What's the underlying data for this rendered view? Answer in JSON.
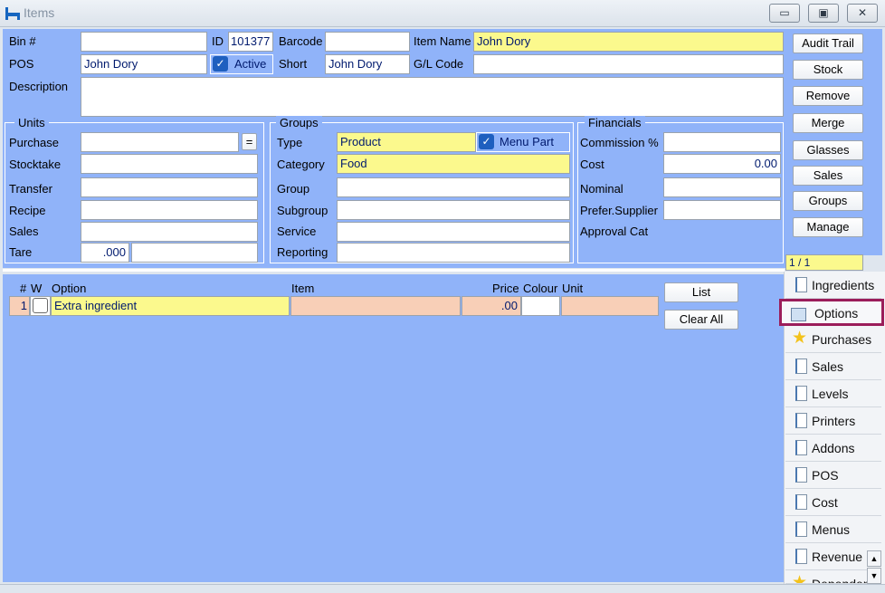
{
  "window": {
    "title": "Items",
    "controls": [
      "▭",
      "▣",
      "✕"
    ]
  },
  "header": {
    "bin_label": "Bin #",
    "bin_value": "",
    "id_label": "ID",
    "id_value": "101377",
    "barcode_label": "Barcode",
    "barcode_value": "",
    "item_name_label": "Item Name",
    "item_name_value": "John Dory",
    "pos_label": "POS",
    "pos_value": "John Dory",
    "active_label": "Active",
    "short_label": "Short",
    "short_value": "John Dory",
    "gl_code_label": "G/L Code",
    "gl_code_value": "",
    "description_label": "Description",
    "description_value": ""
  },
  "units": {
    "title": "Units",
    "purchase_label": "Purchase",
    "purchase_value": "",
    "eq_button": "=",
    "stocktake_label": "Stocktake",
    "stocktake_value": "",
    "transfer_label": "Transfer",
    "transfer_value": "",
    "recipe_label": "Recipe",
    "recipe_value": "",
    "sales_label": "Sales",
    "sales_value": "",
    "tare_label": "Tare",
    "tare_value": ".000"
  },
  "groups": {
    "title": "Groups",
    "type_label": "Type",
    "type_value": "Product",
    "menu_part_label": "Menu Part",
    "category_label": "Category",
    "category_value": "Food",
    "group_label": "Group",
    "group_value": "",
    "subgroup_label": "Subgroup",
    "subgroup_value": "",
    "service_label": "Service",
    "service_value": "",
    "reporting_label": "Reporting",
    "reporting_value": ""
  },
  "financials": {
    "title": "Financials",
    "commission_label": "Commission %",
    "commission_value": "",
    "cost_label": "Cost",
    "cost_value": "0.00",
    "nominal_label": "Nominal",
    "nominal_value": "",
    "prefer_supplier_label": "Prefer.Supplier",
    "prefer_supplier_value": "",
    "approval_cat_label": "Approval Cat"
  },
  "side_buttons": [
    "Audit Trail",
    "Stock",
    "Remove",
    "Merge",
    "Glasses",
    "Sales",
    "Groups",
    "Manage"
  ],
  "record_counter": "1 / 1",
  "options_grid": {
    "headers": {
      "num": "#",
      "w": "W",
      "option": "Option",
      "item": "Item",
      "price": "Price",
      "colour": "Colour",
      "unit": "Unit"
    },
    "rows": [
      {
        "num": "1",
        "option": "Extra ingredient",
        "item": "",
        "price": ".00",
        "colour": "",
        "unit": ""
      }
    ],
    "list_button": "List",
    "clear_all_button": "Clear All"
  },
  "tabs": [
    "Ingredients",
    "Options",
    "Purchases",
    "Sales",
    "Levels",
    "Printers",
    "Addons",
    "POS",
    "Cost",
    "Menus",
    "Revenue",
    "Dependents"
  ],
  "colors": {
    "panel_blue": "#90b3f9",
    "field_yellow": "#fbf98d",
    "grid_salmon": "#f8cfb7",
    "highlight_border": "#9b1d5a"
  }
}
